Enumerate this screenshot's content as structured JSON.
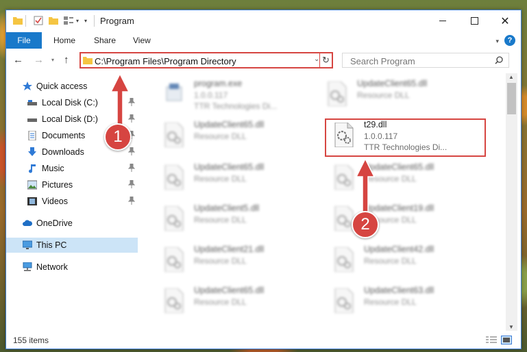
{
  "window": {
    "title": "Program"
  },
  "ribbon": {
    "tabs": [
      "File",
      "Home",
      "Share",
      "View"
    ],
    "help": "?"
  },
  "address": {
    "path": "C:\\Program Files\\Program Directory"
  },
  "search": {
    "placeholder": "Search Program"
  },
  "sidebar": {
    "items": [
      {
        "label": "Quick access",
        "icon": "star-icon",
        "pinned": false
      },
      {
        "label": "Local Disk (C:)",
        "icon": "drive-icon",
        "pinned": true
      },
      {
        "label": "Local Disk (D:)",
        "icon": "drive-icon",
        "pinned": true
      },
      {
        "label": "Documents",
        "icon": "documents-icon",
        "pinned": true
      },
      {
        "label": "Downloads",
        "icon": "download-icon",
        "pinned": true
      },
      {
        "label": "Music",
        "icon": "music-icon",
        "pinned": true
      },
      {
        "label": "Pictures",
        "icon": "pictures-icon",
        "pinned": true
      },
      {
        "label": "Videos",
        "icon": "videos-icon",
        "pinned": true
      },
      {
        "label": "OneDrive",
        "icon": "cloud-icon",
        "pinned": false
      },
      {
        "label": "This PC",
        "icon": "computer-icon",
        "pinned": false,
        "selected": true
      },
      {
        "label": "Network",
        "icon": "network-icon",
        "pinned": false
      }
    ]
  },
  "files": [
    {
      "name": "program.exe",
      "line2": "1.0.0.117",
      "line3": "TTR Technologies Di..."
    },
    {
      "name": "UpdateClient65.dll",
      "line2": "Resource DLL"
    },
    {
      "name": "UpdateClient65.dll",
      "line2": "Resource DLL"
    },
    {
      "name": "t29.dll",
      "line2": "1.0.0.117",
      "line3": "TTR Technologies Di..."
    },
    {
      "name": "UpdateClient65.dll",
      "line2": "Resource DLL"
    },
    {
      "name": "UpdateClient65.dll",
      "line2": "Resource DLL"
    },
    {
      "name": "UpdateClient5.dll",
      "line2": "Resource DLL"
    },
    {
      "name": "UpdateClient19.dll",
      "line2": "Resource DLL"
    },
    {
      "name": "UpdateClient21.dll",
      "line2": "Resource DLL"
    },
    {
      "name": "UpdateClient42.dll",
      "line2": "Resource DLL"
    },
    {
      "name": "UpdateClient65.dll",
      "line2": "Resource DLL"
    },
    {
      "name": "UpdateClient63.dll",
      "line2": "Resource DLL"
    }
  ],
  "status": {
    "count": "155 items"
  },
  "annotations": {
    "badge1": "1",
    "badge2": "2",
    "color": "#d64541"
  },
  "colors": {
    "accent": "#1979ca",
    "selection": "#cce4f7",
    "highlight": "#d64541"
  }
}
